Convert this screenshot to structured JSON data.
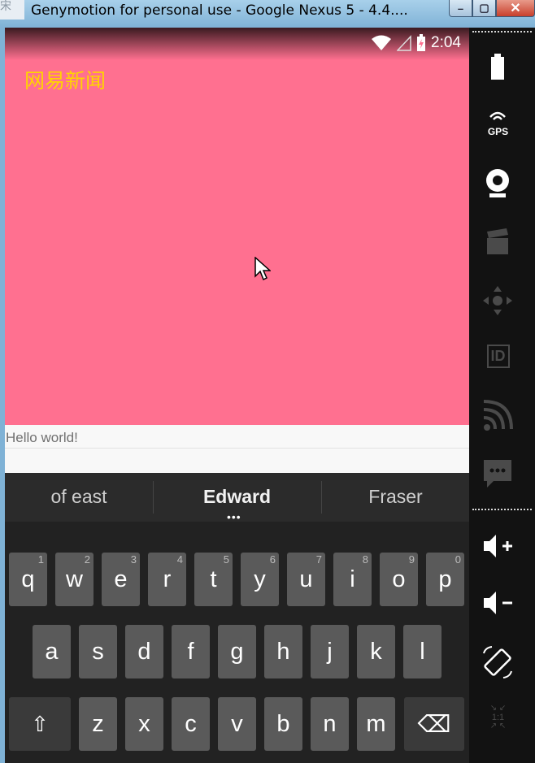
{
  "window": {
    "title": "Genymotion for personal use - Google Nexus 5 - 4.4....",
    "icon_char": "宋",
    "min_label": "–",
    "max_label": "▢",
    "close_label": "✕"
  },
  "status_bar": {
    "time": "2:04",
    "icons": [
      "wifi-icon",
      "signal-icon",
      "battery-charging-icon"
    ]
  },
  "app": {
    "title": "网易新闻",
    "colors": {
      "background": "#ff7090",
      "title": "#ffd400"
    }
  },
  "text_field": {
    "value": "Hello world!"
  },
  "keyboard": {
    "suggestions": [
      "of east",
      "Edward",
      "Fraser"
    ],
    "more_indicator": "•••",
    "row1": [
      {
        "key": "q",
        "num": "1"
      },
      {
        "key": "w",
        "num": "2"
      },
      {
        "key": "e",
        "num": "3"
      },
      {
        "key": "r",
        "num": "4"
      },
      {
        "key": "t",
        "num": "5"
      },
      {
        "key": "y",
        "num": "6"
      },
      {
        "key": "u",
        "num": "7"
      },
      {
        "key": "i",
        "num": "8"
      },
      {
        "key": "o",
        "num": "9"
      },
      {
        "key": "p",
        "num": "0"
      }
    ],
    "row2": [
      "a",
      "s",
      "d",
      "f",
      "g",
      "h",
      "j",
      "k",
      "l"
    ],
    "row3": [
      "z",
      "x",
      "c",
      "v",
      "b",
      "n",
      "m"
    ],
    "shift_label": "⇧",
    "delete_label": "⌫"
  },
  "side_panel": {
    "icons": [
      "battery-icon",
      "gps-icon",
      "webcam-icon",
      "video-capture-icon",
      "dpad-icon",
      "device-id-icon",
      "cast-icon",
      "sms-icon",
      "volume-up-icon",
      "volume-down-icon",
      "rotate-icon",
      "pixel-perfect-icon"
    ],
    "gps_label": "GPS",
    "id_label": "ID",
    "ratio_label": "1:1"
  }
}
